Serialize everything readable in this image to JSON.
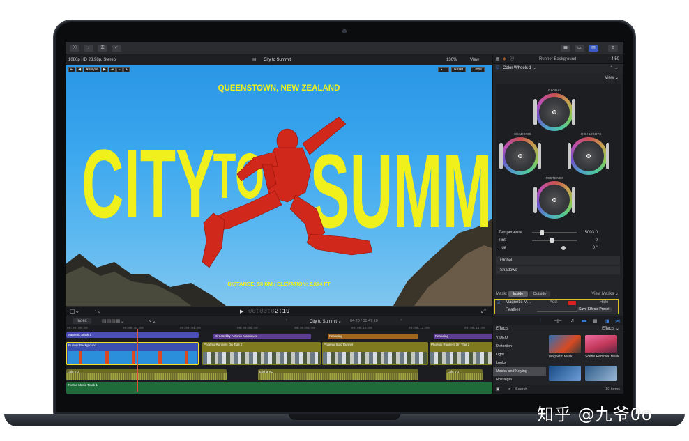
{
  "watermark": "知乎 @九爷0o",
  "viewer": {
    "format": "1080p HD 23.98p, Stereo",
    "project": "City to Summit",
    "zoom": "136%",
    "view_menu": "View",
    "analyze": "Analyze",
    "reset": "Reset",
    "done": "Done",
    "timecode_dim": "00:00:0",
    "timecode_bright": "2:19"
  },
  "poster": {
    "location": "QUEENSTOWN, NEW ZEALAND",
    "word1": "CITY",
    "word2": "TO",
    "word3": "SUMMIT",
    "stats": "DISTANCE: 50 KM / ELEVATION: 2,894 FT"
  },
  "inspector": {
    "clip_name": "Runner Background",
    "duration": "4:50",
    "effect": "Color Wheels 1",
    "view_menu": "View",
    "wheels": {
      "global": "GLOBAL",
      "shadows": "SHADOWS",
      "highlights": "HIGHLIGHTS",
      "midtones": "MIDTONES"
    },
    "temperature_label": "Temperature",
    "temperature_value": "5003.0",
    "tint_label": "Tint",
    "tint_value": "0",
    "hue_label": "Hue",
    "hue_value": "0 °",
    "sections": [
      "Global",
      "Shadows"
    ],
    "mask_label": "Mask:",
    "mask_inside": "Inside",
    "mask_outside": "Outside",
    "view_masks": "View Masks",
    "mask_name": "Magnetic M...",
    "mask_add": "Add",
    "mask_hide": "Hide",
    "feather_label": "Feather",
    "feather_value": "0",
    "save_preset": "Save Effects Preset"
  },
  "timeline": {
    "index": "Index",
    "project": "City to Summit",
    "duration": "04:20 / 01:47:10",
    "ruler": [
      "00:00:00:00",
      "00:00:02:00",
      "00:00:04:00",
      "00:00:06:00",
      "00:00:08:00",
      "00:00:10:00",
      "00:00:12:00",
      "00:00:14:00"
    ],
    "clips": {
      "mask": "Magnetic Mask 1",
      "runner": "Runner Background",
      "title1": "Directed by Antonio Manriquez",
      "title2": "Featuring",
      "title3": "Featuring",
      "phoenix1": "Phoenix Runners On Trail 2",
      "phoenix2": "Phoenix Solo Runner",
      "phoenix3": "Phoenix Runners On Trail 2",
      "vo1": "Lulu VO",
      "vo2": "Elisha VO",
      "vo3": "Lulu VO",
      "music": "Theme Music Track 1"
    }
  },
  "effects": {
    "title": "Effects",
    "title_right": "Effects",
    "categories": [
      "VIDEO",
      "Distortion",
      "Light",
      "Looks",
      "Masks and Keying",
      "Nostalgia"
    ],
    "selected": "Masks and Keying",
    "tiles": [
      "Magnetic Mask",
      "Scene Removal Mask"
    ],
    "search_placeholder": "Search",
    "count": "10 items"
  }
}
